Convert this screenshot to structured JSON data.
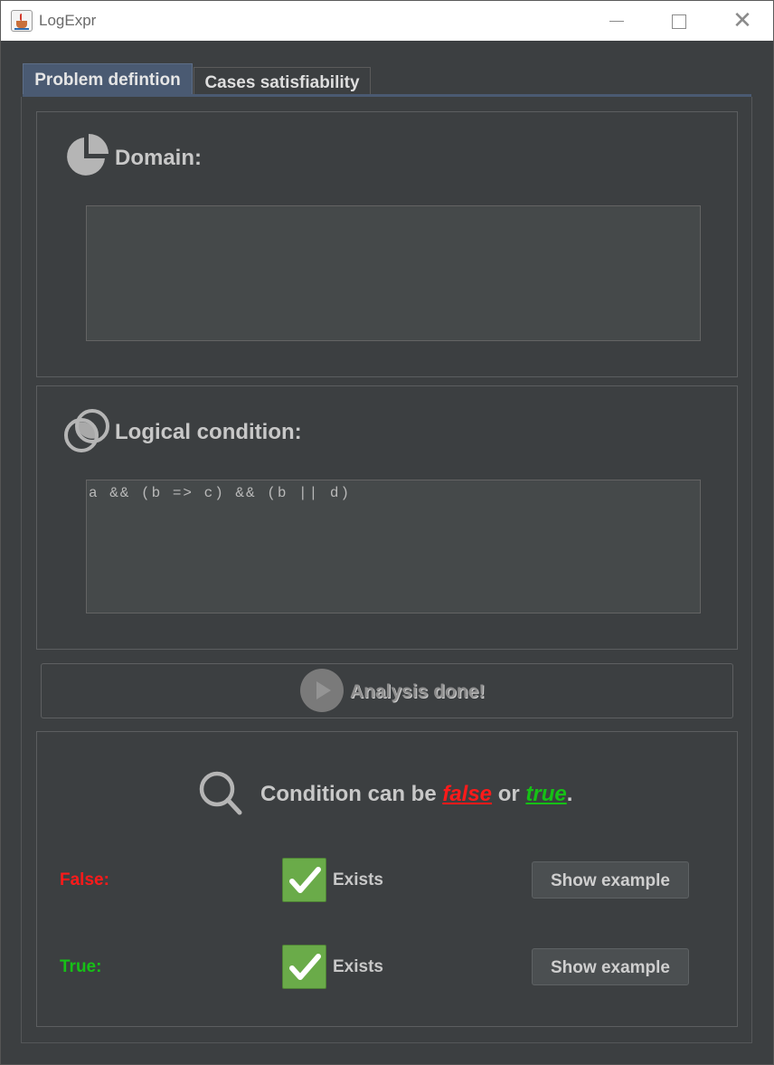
{
  "window": {
    "title": "LogExpr",
    "close_glyph": "✕"
  },
  "tabs": [
    {
      "label": "Problem defintion",
      "active": true
    },
    {
      "label": "Cases satisfiability",
      "active": false
    }
  ],
  "domain": {
    "title": "Domain:",
    "value": "",
    "icon": "pie-chart-icon"
  },
  "condition": {
    "title": "Logical condition:",
    "value": "a && (b => c) && (b || d)",
    "icon": "venn-icon"
  },
  "analyze": {
    "label": "Analysis done!",
    "icon": "play-icon"
  },
  "result": {
    "prefix": "Condition can be ",
    "false_word": "false",
    "middle": " or ",
    "true_word": "true",
    "suffix": ".",
    "icon": "magnifier-icon",
    "rows": [
      {
        "label": "False:",
        "status": "Exists",
        "checked": true,
        "button": "Show example"
      },
      {
        "label": "True:",
        "status": "Exists",
        "checked": true,
        "button": "Show example"
      }
    ]
  },
  "colors": {
    "background": "#3c3f41",
    "tab_active": "#4a5a72",
    "false_color": "#ff1a1a",
    "true_color": "#16c016",
    "check_bg": "#6aab49"
  }
}
